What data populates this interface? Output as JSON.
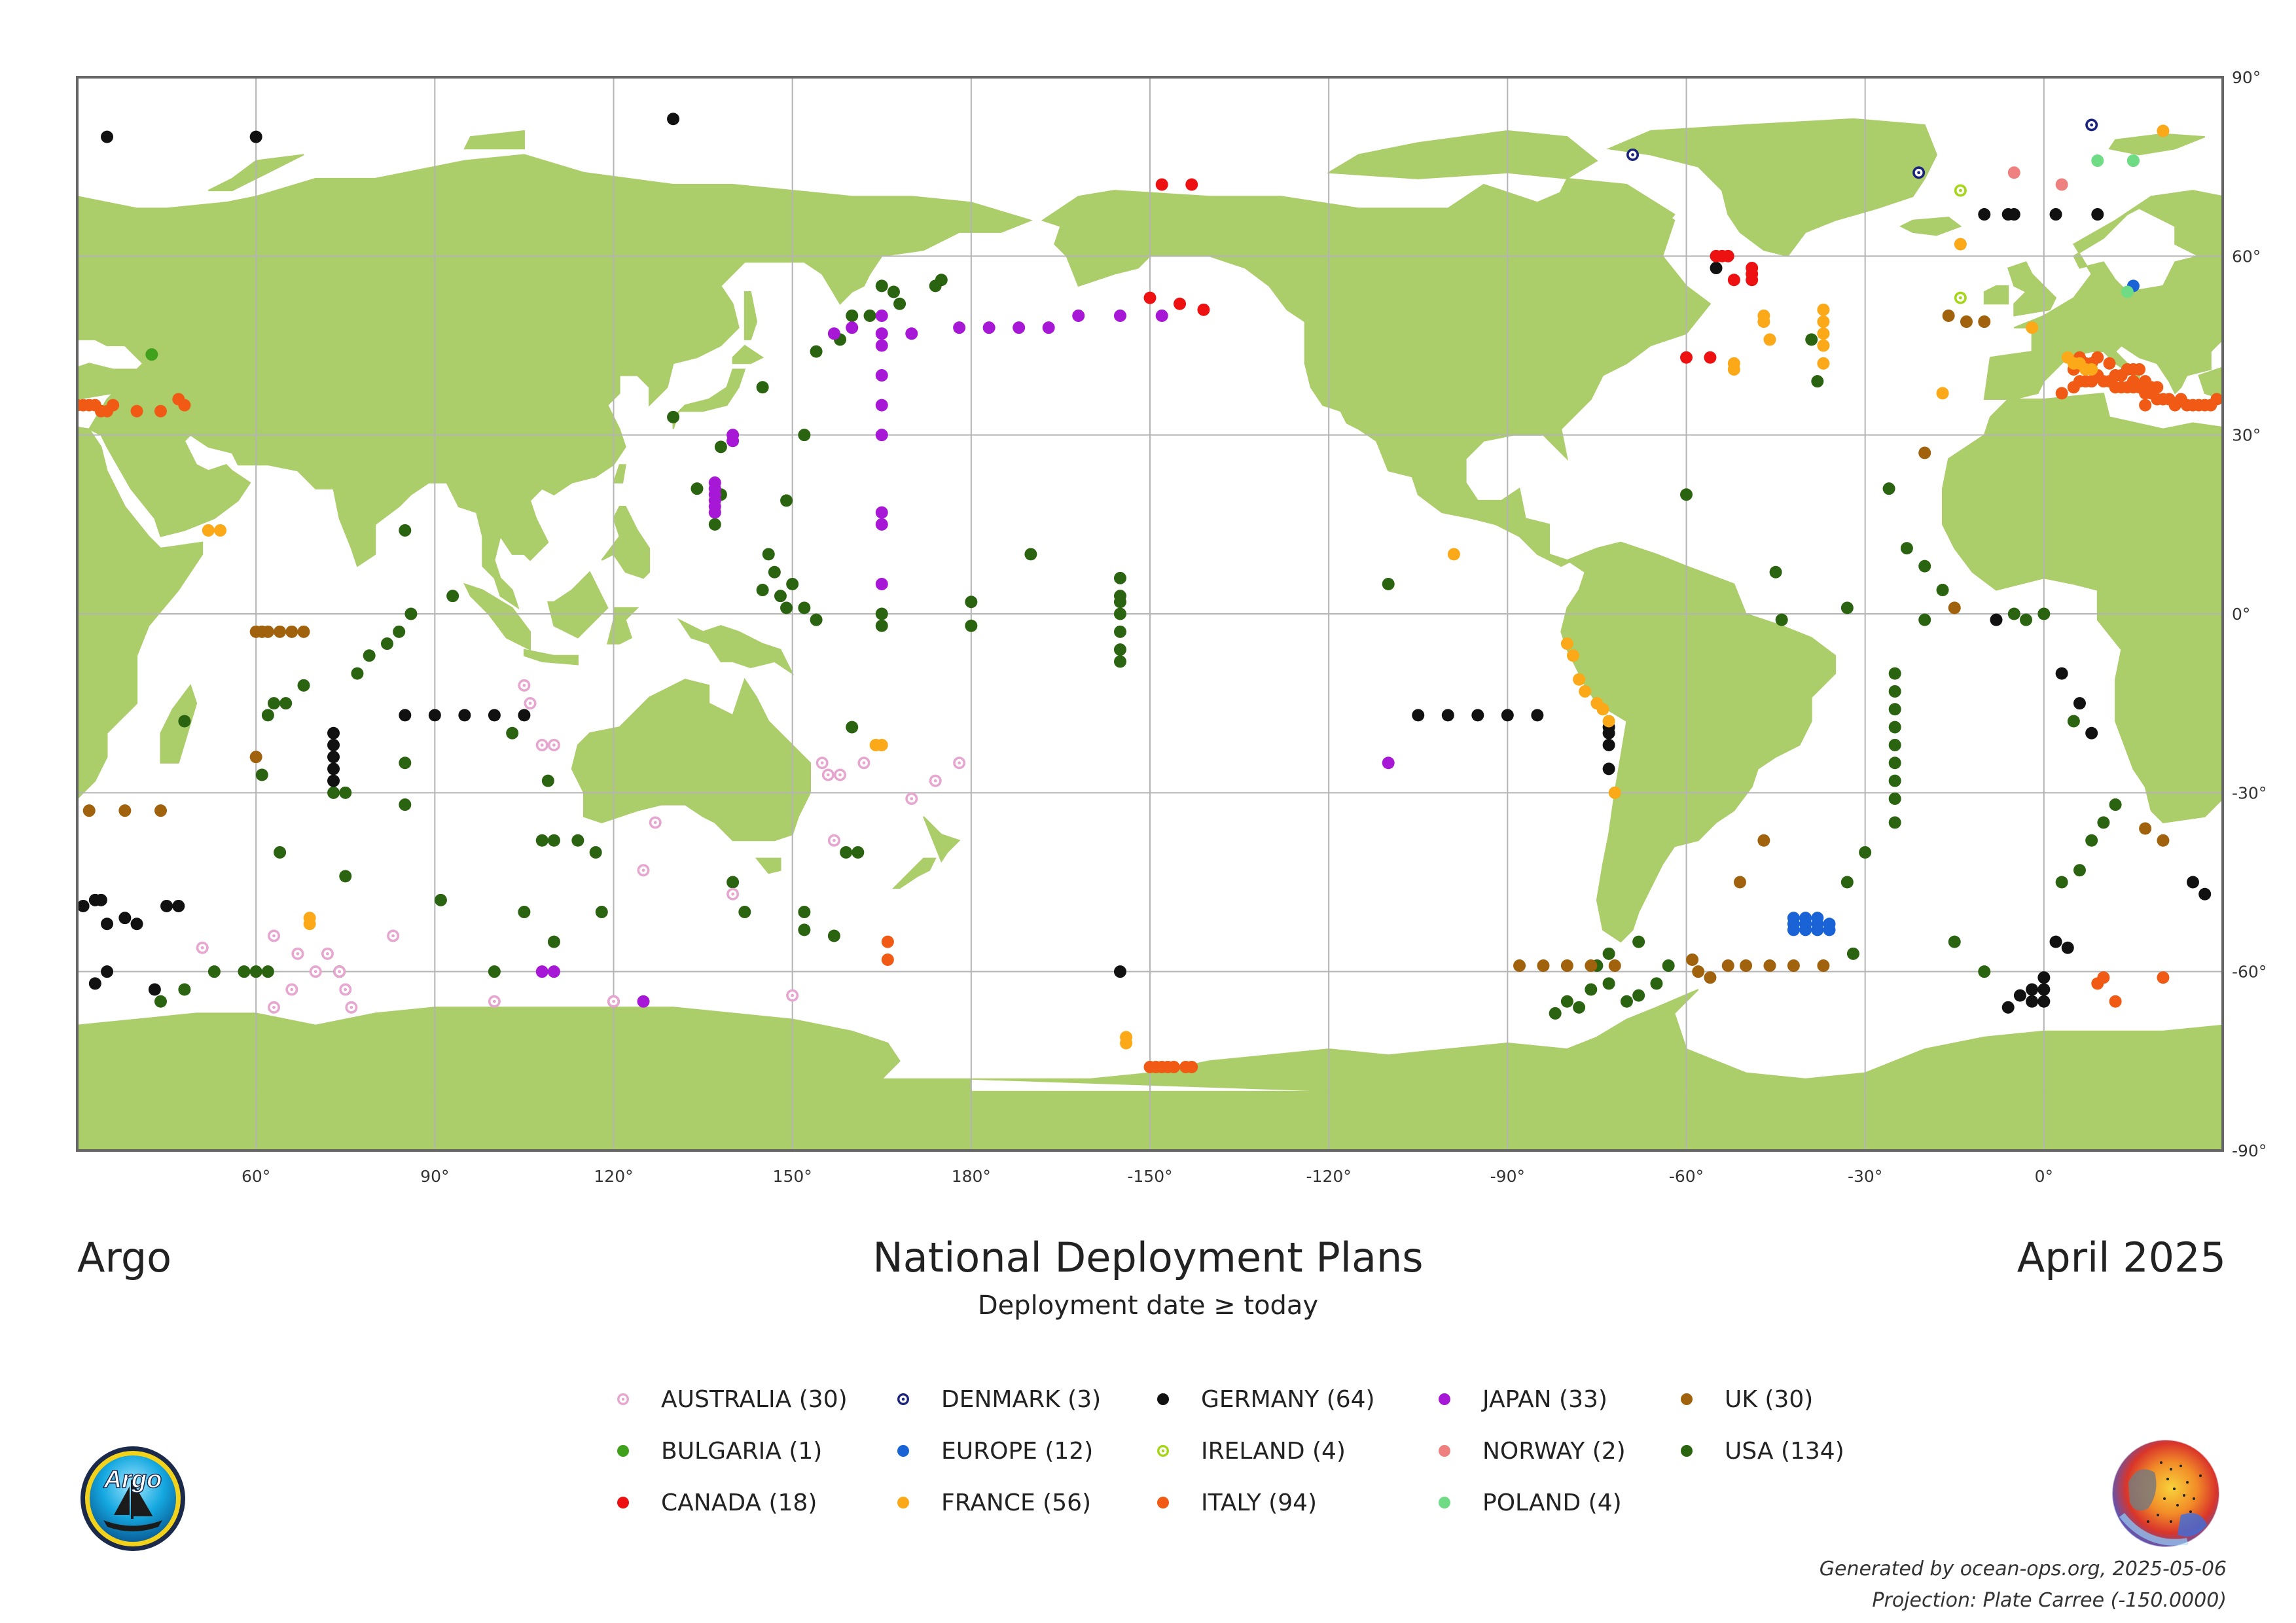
{
  "header": {
    "left_title": "Argo",
    "main_title": "National Deployment Plans",
    "subtitle": "Deployment date ≥ today",
    "right_title": "April 2025"
  },
  "footer": {
    "generated": "Generated by ocean-ops.org, 2025-05-06",
    "projection": "Projection: Plate Carree (-150.0000)"
  },
  "map": {
    "central_longitude": -150,
    "land_color": "#abcd6a",
    "ocean_color": "#ffffff",
    "grid_color": "#b4b4b4",
    "lon_ticks": [
      "60°",
      "90°",
      "120°",
      "150°",
      "180°",
      "-150°",
      "-120°",
      "-90°",
      "-60°",
      "-30°",
      "0°"
    ],
    "lat_ticks": [
      "90°",
      "60°",
      "30°",
      "0°",
      "-30°",
      "-60°",
      "-90°"
    ]
  },
  "legend": [
    {
      "key": "australia",
      "label": "AUSTRALIA (30)",
      "color": "#e6a6cf",
      "style": "ring"
    },
    {
      "key": "bulgaria",
      "label": "BULGARIA (1)",
      "color": "#3fa11c",
      "style": "solid"
    },
    {
      "key": "canada",
      "label": "CANADA (18)",
      "color": "#ee1111",
      "style": "solid"
    },
    {
      "key": "denmark",
      "label": "DENMARK (3)",
      "color": "#1a237e",
      "style": "ring"
    },
    {
      "key": "europe",
      "label": "EUROPE (12)",
      "color": "#1a63d6",
      "style": "solid"
    },
    {
      "key": "france",
      "label": "FRANCE (56)",
      "color": "#fba919",
      "style": "solid"
    },
    {
      "key": "germany",
      "label": "GERMANY (64)",
      "color": "#111111",
      "style": "solid"
    },
    {
      "key": "ireland",
      "label": "IRELAND (4)",
      "color": "#a4d617",
      "style": "ring"
    },
    {
      "key": "italy",
      "label": "ITALY (94)",
      "color": "#f05a14",
      "style": "solid"
    },
    {
      "key": "japan",
      "label": "JAPAN (33)",
      "color": "#a617d6",
      "style": "solid"
    },
    {
      "key": "norway",
      "label": "NORWAY (2)",
      "color": "#ee8080",
      "style": "solid"
    },
    {
      "key": "poland",
      "label": "POLAND (4)",
      "color": "#6fdb84",
      "style": "solid"
    },
    {
      "key": "uk",
      "label": "UK (30)",
      "color": "#a0620c",
      "style": "solid"
    },
    {
      "key": "usa",
      "label": "USA (134)",
      "color": "#2b6410",
      "style": "solid"
    }
  ],
  "deployments": {
    "australia": [
      [
        51,
        -56
      ],
      [
        63,
        -54
      ],
      [
        67,
        -57
      ],
      [
        70,
        -60
      ],
      [
        72,
        -57
      ],
      [
        74,
        -60
      ],
      [
        66,
        -63
      ],
      [
        63,
        -66
      ],
      [
        75,
        -63
      ],
      [
        76,
        -66
      ],
      [
        83,
        -54
      ],
      [
        105,
        -12
      ],
      [
        106,
        -15
      ],
      [
        108,
        -22
      ],
      [
        110,
        -22
      ],
      [
        100,
        -65
      ],
      [
        120,
        -65
      ],
      [
        125,
        -43
      ],
      [
        127,
        -35
      ],
      [
        140,
        -47
      ],
      [
        150,
        -64
      ],
      [
        155,
        -25
      ],
      [
        156,
        -27
      ],
      [
        158,
        -27
      ],
      [
        162,
        -25
      ],
      [
        170,
        -31
      ],
      [
        174,
        -28
      ],
      [
        178,
        -25
      ],
      [
        157,
        -38
      ]
    ],
    "bulgaria": [
      [
        42.5,
        43.5
      ]
    ],
    "canada": [
      [
        -150,
        53
      ],
      [
        -145,
        52
      ],
      [
        -141,
        51
      ],
      [
        -143,
        72
      ],
      [
        -148,
        72
      ],
      [
        -60,
        43
      ],
      [
        -56,
        43
      ],
      [
        -54,
        60
      ],
      [
        -52,
        56
      ],
      [
        -49,
        56
      ],
      [
        -49,
        57
      ],
      [
        -49,
        58
      ],
      [
        -55,
        60
      ],
      [
        -53,
        60
      ]
    ],
    "denmark": [
      [
        -69,
        77
      ],
      [
        -21,
        74
      ],
      [
        8,
        82
      ]
    ],
    "europe": [
      [
        -42,
        -52
      ],
      [
        -40,
        -52
      ],
      [
        -38,
        -52
      ],
      [
        -36,
        -52
      ],
      [
        -42,
        -53
      ],
      [
        -40,
        -53
      ],
      [
        -38,
        -53
      ],
      [
        -36,
        -53
      ],
      [
        -42,
        -51
      ],
      [
        -40,
        -51
      ],
      [
        -38,
        -51
      ],
      [
        15,
        55
      ]
    ],
    "france": [
      [
        -47,
        49
      ],
      [
        -47,
        50
      ],
      [
        -46,
        46
      ],
      [
        -52,
        42
      ],
      [
        -52,
        41
      ],
      [
        -37,
        51
      ],
      [
        -37,
        49
      ],
      [
        -37,
        47
      ],
      [
        -37,
        45
      ],
      [
        -37,
        42
      ],
      [
        -14,
        62
      ],
      [
        -17,
        37
      ],
      [
        -2,
        48
      ],
      [
        4,
        43
      ],
      [
        5,
        42
      ],
      [
        6,
        42
      ],
      [
        7,
        41
      ],
      [
        8,
        41
      ],
      [
        20,
        81
      ],
      [
        -99,
        10
      ],
      [
        -80,
        -5
      ],
      [
        -79,
        -7
      ],
      [
        -78,
        -11
      ],
      [
        -77,
        -13
      ],
      [
        -75,
        -15
      ],
      [
        -74,
        -16
      ],
      [
        -73,
        -18
      ],
      [
        -72,
        -30
      ],
      [
        -15,
        1
      ],
      [
        164,
        -22
      ],
      [
        165,
        -22
      ],
      [
        69,
        -51
      ],
      [
        69,
        -52
      ],
      [
        52,
        14
      ],
      [
        54,
        14
      ],
      [
        -154,
        -71
      ],
      [
        -154,
        -72
      ]
    ],
    "germany": [
      [
        60,
        80
      ],
      [
        130,
        83
      ],
      [
        -55,
        58
      ],
      [
        -10,
        67
      ],
      [
        -6,
        67
      ],
      [
        -5,
        67
      ],
      [
        2,
        67
      ],
      [
        9,
        67
      ],
      [
        35,
        80
      ],
      [
        85,
        -17
      ],
      [
        90,
        -17
      ],
      [
        95,
        -17
      ],
      [
        100,
        -17
      ],
      [
        105,
        -17
      ],
      [
        73,
        -20
      ],
      [
        73,
        -22
      ],
      [
        73,
        -24
      ],
      [
        73,
        -26
      ],
      [
        73,
        -28
      ],
      [
        -105,
        -17
      ],
      [
        -100,
        -17
      ],
      [
        -95,
        -17
      ],
      [
        -90,
        -17
      ],
      [
        -85,
        -17
      ],
      [
        -73,
        -20
      ],
      [
        -73,
        -22
      ],
      [
        -73,
        -26
      ],
      [
        -73,
        -19
      ],
      [
        -8,
        -1
      ],
      [
        3,
        -10
      ],
      [
        6,
        -15
      ],
      [
        8,
        -20
      ],
      [
        25,
        -45
      ],
      [
        27,
        -47
      ],
      [
        31,
        -49
      ],
      [
        33,
        -48
      ],
      [
        35,
        -52
      ],
      [
        38,
        -51
      ],
      [
        40,
        -52
      ],
      [
        43,
        -63
      ],
      [
        45,
        -49
      ],
      [
        47,
        -49
      ],
      [
        35,
        -60
      ],
      [
        33,
        -62
      ],
      [
        -2,
        -63
      ],
      [
        0,
        -63
      ],
      [
        0,
        -65
      ],
      [
        -2,
        -65
      ],
      [
        -6,
        -66
      ],
      [
        -4,
        -64
      ],
      [
        0,
        -61
      ],
      [
        4,
        -56
      ],
      [
        2,
        -55
      ],
      [
        34,
        -48
      ],
      [
        -155,
        -60
      ]
    ],
    "ireland": [
      [
        -14,
        71
      ],
      [
        -14,
        53
      ]
    ],
    "italy": [
      [
        40,
        34
      ],
      [
        44,
        34
      ],
      [
        47,
        36
      ],
      [
        48,
        35
      ],
      [
        -150,
        -76
      ],
      [
        -149,
        -76
      ],
      [
        -148,
        -76
      ],
      [
        -147,
        -76
      ],
      [
        -146,
        -76
      ],
      [
        -144,
        -76
      ],
      [
        -143,
        -76
      ],
      [
        3,
        37
      ],
      [
        5,
        38
      ],
      [
        6,
        39
      ],
      [
        7,
        39
      ],
      [
        8,
        39
      ],
      [
        9,
        40
      ],
      [
        10,
        39
      ],
      [
        11,
        39
      ],
      [
        12,
        40
      ],
      [
        13,
        40
      ],
      [
        14,
        41
      ],
      [
        15,
        41
      ],
      [
        16,
        41
      ],
      [
        7,
        42
      ],
      [
        8,
        42
      ],
      [
        9,
        43
      ],
      [
        6,
        43
      ],
      [
        5,
        41
      ],
      [
        11,
        42
      ],
      [
        12,
        38
      ],
      [
        13,
        38
      ],
      [
        14,
        38
      ],
      [
        15,
        38
      ],
      [
        16,
        38
      ],
      [
        17,
        37
      ],
      [
        18,
        37
      ],
      [
        19,
        36
      ],
      [
        20,
        36
      ],
      [
        21,
        36
      ],
      [
        22,
        35
      ],
      [
        23,
        36
      ],
      [
        24,
        35
      ],
      [
        25,
        35
      ],
      [
        26,
        35
      ],
      [
        27,
        35
      ],
      [
        28,
        35
      ],
      [
        29,
        36
      ],
      [
        30,
        35
      ],
      [
        31,
        35
      ],
      [
        32,
        35
      ],
      [
        33,
        35
      ],
      [
        34,
        34
      ],
      [
        35,
        34
      ],
      [
        36,
        35
      ],
      [
        15,
        39
      ],
      [
        17,
        39
      ],
      [
        18,
        38
      ],
      [
        19,
        38
      ],
      [
        17,
        35
      ],
      [
        166,
        -55
      ],
      [
        166,
        -58
      ],
      [
        9,
        -62
      ],
      [
        10,
        -61
      ],
      [
        12,
        -65
      ],
      [
        20,
        -61
      ]
    ],
    "japan": [
      [
        140,
        29
      ],
      [
        140,
        30
      ],
      [
        137,
        22
      ],
      [
        137,
        21
      ],
      [
        137,
        20
      ],
      [
        137,
        19
      ],
      [
        137,
        18
      ],
      [
        137,
        17
      ],
      [
        165,
        17
      ],
      [
        165,
        15
      ],
      [
        165,
        5
      ],
      [
        165,
        30
      ],
      [
        165,
        35
      ],
      [
        165,
        40
      ],
      [
        165,
        45
      ],
      [
        165,
        47
      ],
      [
        165,
        50
      ],
      [
        157,
        47
      ],
      [
        160,
        48
      ],
      [
        170,
        47
      ],
      [
        178,
        48
      ],
      [
        183,
        48
      ],
      [
        188,
        48
      ],
      [
        193,
        48
      ],
      [
        198,
        50
      ],
      [
        205,
        50
      ],
      [
        212,
        50
      ],
      [
        -110,
        -25
      ],
      [
        108,
        -60
      ],
      [
        110,
        -60
      ],
      [
        120,
        -65
      ],
      [
        125,
        -65
      ]
    ],
    "norway": [
      [
        -5,
        74
      ],
      [
        3,
        72
      ]
    ],
    "poland": [
      [
        9,
        76
      ],
      [
        15,
        76
      ],
      [
        15,
        76
      ],
      [
        14,
        54
      ]
    ],
    "uk": [
      [
        -72,
        -59
      ],
      [
        -76,
        -59
      ],
      [
        -80,
        -59
      ],
      [
        -84,
        -59
      ],
      [
        -88,
        -59
      ],
      [
        -59,
        -58
      ],
      [
        -58,
        -60
      ],
      [
        -56,
        -61
      ],
      [
        -53,
        -59
      ],
      [
        -50,
        -59
      ],
      [
        -46,
        -59
      ],
      [
        -42,
        -59
      ],
      [
        -37,
        -59
      ],
      [
        -47,
        -38
      ],
      [
        -51,
        -45
      ],
      [
        -20,
        27
      ],
      [
        -16,
        50
      ],
      [
        -13,
        49
      ],
      [
        -10,
        49
      ],
      [
        -15,
        1
      ],
      [
        17,
        -36
      ],
      [
        20,
        -38
      ],
      [
        60,
        -3
      ],
      [
        61,
        -3
      ],
      [
        62,
        -3
      ],
      [
        64,
        -3
      ],
      [
        66,
        -3
      ],
      [
        68,
        -3
      ],
      [
        32,
        -33
      ],
      [
        38,
        -33
      ],
      [
        44,
        -33
      ],
      [
        60,
        -24
      ]
    ],
    "usa": [
      [
        -5,
        0
      ],
      [
        -20,
        -1
      ],
      [
        -17,
        4
      ],
      [
        -20,
        8
      ],
      [
        -23,
        11
      ],
      [
        -26,
        21
      ],
      [
        -44,
        -1
      ],
      [
        -45,
        7
      ],
      [
        -60,
        20
      ],
      [
        -33,
        1
      ],
      [
        -25,
        -10
      ],
      [
        -25,
        -13
      ],
      [
        -25,
        -16
      ],
      [
        -25,
        -19
      ],
      [
        -25,
        -22
      ],
      [
        -25,
        -25
      ],
      [
        -25,
        -28
      ],
      [
        -25,
        -31
      ],
      [
        -25,
        -35
      ],
      [
        -30,
        -40
      ],
      [
        -33,
        -45
      ],
      [
        -32,
        -57
      ],
      [
        -38,
        39
      ],
      [
        -39,
        46
      ],
      [
        -15,
        -55
      ],
      [
        -10,
        -60
      ],
      [
        3,
        -45
      ],
      [
        6,
        -43
      ],
      [
        8,
        -38
      ],
      [
        10,
        -35
      ],
      [
        12,
        -32
      ],
      [
        -3,
        -1
      ],
      [
        0,
        0
      ],
      [
        5,
        -18
      ],
      [
        -63,
        -59
      ],
      [
        -65,
        -62
      ],
      [
        -68,
        -64
      ],
      [
        -70,
        -65
      ],
      [
        -73,
        -62
      ],
      [
        -75,
        -59
      ],
      [
        -76,
        -63
      ],
      [
        -80,
        -65
      ],
      [
        -82,
        -67
      ],
      [
        -78,
        -66
      ],
      [
        -73,
        -57
      ],
      [
        -68,
        -55
      ],
      [
        -110,
        5
      ],
      [
        -155,
        6
      ],
      [
        -155,
        3
      ],
      [
        -155,
        2
      ],
      [
        -155,
        0
      ],
      [
        -155,
        -3
      ],
      [
        -155,
        -6
      ],
      [
        -155,
        -8
      ],
      [
        -170,
        10
      ],
      [
        -180,
        2
      ],
      [
        -180,
        -2
      ],
      [
        165,
        -2
      ],
      [
        165,
        0
      ],
      [
        160,
        -19
      ],
      [
        152,
        -53
      ],
      [
        149,
        19
      ],
      [
        149,
        1
      ],
      [
        145,
        4
      ],
      [
        146,
        10
      ],
      [
        147,
        7
      ],
      [
        148,
        3
      ],
      [
        150,
        5
      ],
      [
        152,
        1
      ],
      [
        154,
        -1
      ],
      [
        152,
        30
      ],
      [
        154,
        44
      ],
      [
        158,
        46
      ],
      [
        160,
        50
      ],
      [
        163,
        50
      ],
      [
        168,
        52
      ],
      [
        167,
        54
      ],
      [
        165,
        55
      ],
      [
        174,
        55
      ],
      [
        175,
        56
      ],
      [
        137,
        15
      ],
      [
        138,
        20
      ],
      [
        134,
        21
      ],
      [
        138,
        28
      ],
      [
        130,
        33
      ],
      [
        145,
        38
      ],
      [
        117,
        -40
      ],
      [
        114,
        -38
      ],
      [
        110,
        -38
      ],
      [
        110,
        -55
      ],
      [
        105,
        -50
      ],
      [
        103,
        -20
      ],
      [
        109,
        -28
      ],
      [
        118,
        -50
      ],
      [
        140,
        -45
      ],
      [
        142,
        -50
      ],
      [
        152,
        -50
      ],
      [
        157,
        -54
      ],
      [
        159,
        -40
      ],
      [
        161,
        -40
      ],
      [
        61,
        -27
      ],
      [
        63,
        -15
      ],
      [
        68,
        -12
      ],
      [
        75,
        -30
      ],
      [
        75,
        -44
      ],
      [
        77,
        -10
      ],
      [
        79,
        -7
      ],
      [
        82,
        -5
      ],
      [
        84,
        -3
      ],
      [
        86,
        0
      ],
      [
        93,
        3
      ],
      [
        85,
        14
      ],
      [
        85,
        -25
      ],
      [
        85,
        -32
      ],
      [
        48,
        -18
      ],
      [
        62,
        -17
      ],
      [
        64,
        -40
      ],
      [
        58,
        -60
      ],
      [
        60,
        -60
      ],
      [
        62,
        -60
      ],
      [
        74,
        -60
      ],
      [
        44,
        -65
      ],
      [
        48,
        -63
      ],
      [
        53,
        -60
      ],
      [
        91,
        -48
      ],
      [
        100,
        -60
      ],
      [
        73,
        -30
      ],
      [
        108,
        -38
      ],
      [
        65,
        -15
      ]
    ]
  }
}
